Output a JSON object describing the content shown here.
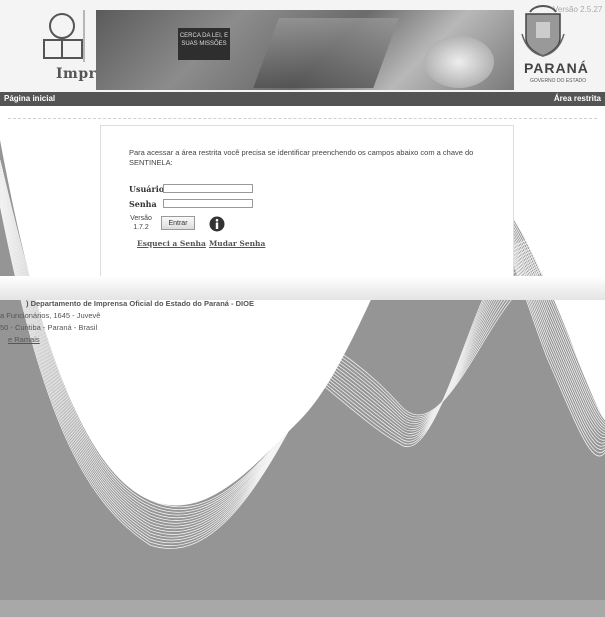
{
  "header": {
    "brand": "ImprensaNet",
    "logo_caption": "Imprensa Oficial",
    "banner_sign": "CERCA DA LEI, E SUAS MISSÕES",
    "version": "Versão 2.5.27",
    "state": "PARANÁ",
    "government": "GOVERNO DO ESTADO",
    "logo_icon": "imprensa-oficial-logo-icon",
    "crest_icon": "parana-crest-icon"
  },
  "nav": {
    "home": "Página inicial",
    "restricted": "Área restrita"
  },
  "login": {
    "instructions": "Para acessar a área restrita você precisa se identificar preenchendo os campos abaixo com a chave do SENTINELA:",
    "user_label": "Usuário",
    "user_value": "",
    "password_label": "Senha",
    "password_value": "",
    "version_label": "Versão",
    "version_number": "1.7.2",
    "submit_label": "Entrar",
    "forgot_link": "Esqueci a Senha",
    "change_link": "Mudar Senha"
  },
  "address": {
    "org": ") Departamento de Imprensa Oficial do Estado do Paraná - DIOE",
    "street": "a Funcionários, 1645 - Juvevê",
    "city": "50 - Curitiba - Paraná - Brasil",
    "phones_link": "e Ramais"
  },
  "colors": {
    "navbar": "#545454",
    "wave_fill": "#959595",
    "wave_lines": "#ffffff"
  }
}
